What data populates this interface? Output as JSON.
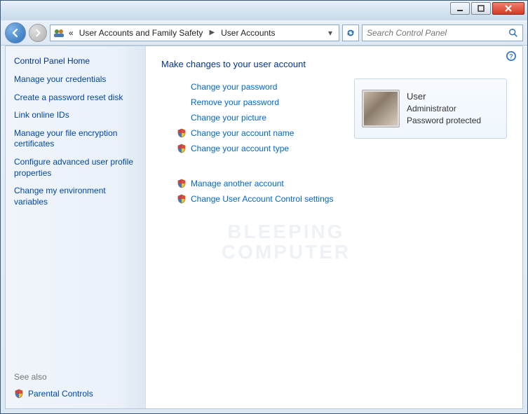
{
  "titlebar": {
    "min_icon": "minimize-icon",
    "max_icon": "maximize-icon",
    "close_icon": "close-icon"
  },
  "address": {
    "chevrons": "«",
    "seg1": "User Accounts and Family Safety",
    "seg2": "User Accounts"
  },
  "search": {
    "placeholder": "Search Control Panel"
  },
  "sidebar": {
    "home": "Control Panel Home",
    "links": [
      "Manage your credentials",
      "Create a password reset disk",
      "Link online IDs",
      "Manage your file encryption certificates",
      "Configure advanced user profile properties",
      "Change my environment variables"
    ],
    "seealso_label": "See also",
    "seealso_link": "Parental Controls"
  },
  "content": {
    "heading": "Make changes to your user account",
    "tasks_top": [
      {
        "shield": false,
        "label": "Change your password"
      },
      {
        "shield": false,
        "label": "Remove your password"
      },
      {
        "shield": false,
        "label": "Change your picture"
      },
      {
        "shield": true,
        "label": "Change your account name"
      },
      {
        "shield": true,
        "label": "Change your account type"
      }
    ],
    "tasks_bottom": [
      {
        "shield": true,
        "label": "Manage another account"
      },
      {
        "shield": true,
        "label": "Change User Account Control settings"
      }
    ]
  },
  "user": {
    "name": "User",
    "role": "Administrator",
    "status": "Password protected"
  },
  "watermark": {
    "line1": "BLEEPING",
    "line2": "COMPUTER"
  }
}
